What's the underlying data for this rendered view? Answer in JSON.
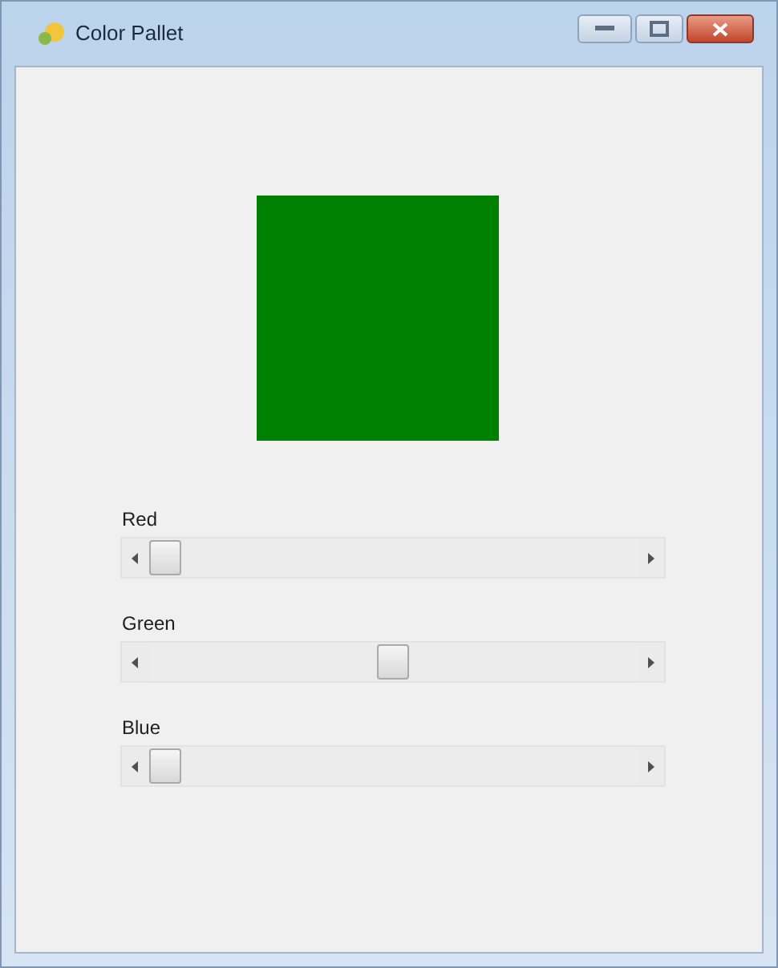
{
  "window": {
    "title": "Color Pallet"
  },
  "preview": {
    "color": "#008000"
  },
  "sliders": [
    {
      "label": "Red",
      "level": 0
    },
    {
      "label": "Green",
      "level": 0.5
    },
    {
      "label": "Blue",
      "level": 0
    }
  ]
}
